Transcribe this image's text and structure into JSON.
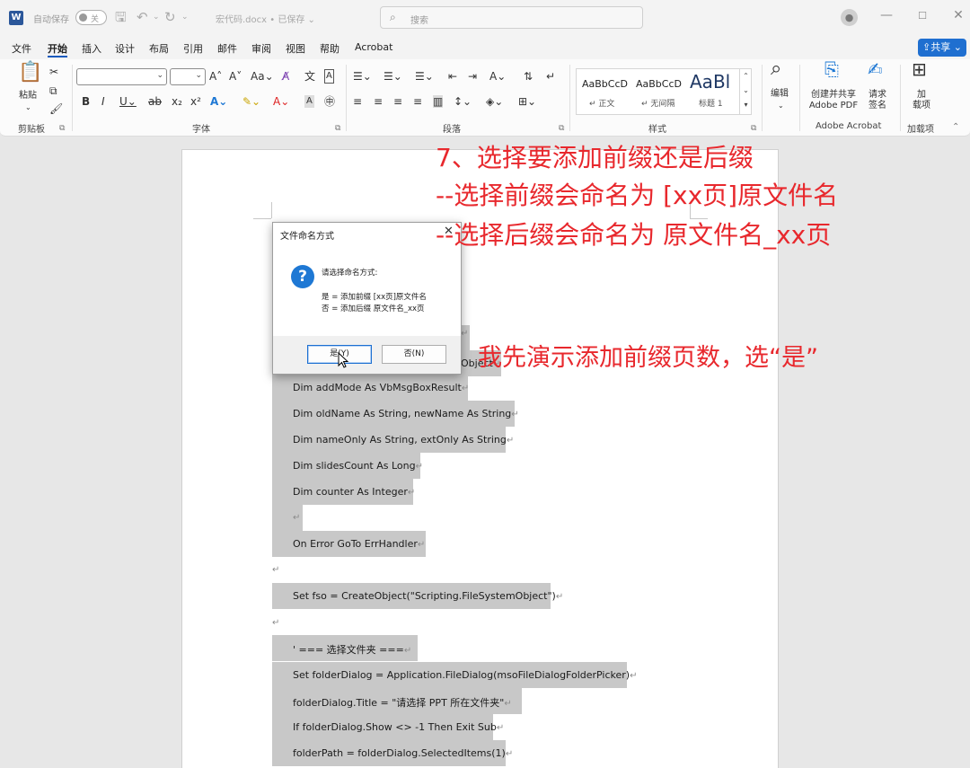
{
  "titlebar": {
    "app_icon": "W",
    "autosave": "自动保存",
    "toggle": "关",
    "doc_name": "宏代码.docx • 已保存 ⌄",
    "search_placeholder": "搜索"
  },
  "menu": {
    "items": [
      "文件",
      "开始",
      "插入",
      "设计",
      "布局",
      "引用",
      "邮件",
      "审阅",
      "视图",
      "帮助",
      "Acrobat"
    ],
    "share": "共享"
  },
  "ribbon": {
    "paste": "粘贴",
    "group_clipboard": "剪贴板",
    "group_font": "字体",
    "group_paragraph": "段落",
    "group_styles": "样式",
    "group_acrobat": "Adobe Acrobat",
    "group_addins": "加载项",
    "styles": [
      {
        "sample": "AaBbCcD",
        "name": "正文"
      },
      {
        "sample": "AaBbCcD",
        "name": "无间隔"
      },
      {
        "sample": "AaBl",
        "name": "标题 1"
      }
    ],
    "edit": "编辑",
    "create_pdf": "创建并共享",
    "create_pdf2": "Adobe PDF",
    "sign": "请求",
    "sign2": "签名",
    "addins": "加",
    "addins2": "载项"
  },
  "annotation": {
    "line1": "7、选择要添加前缀还是后缀",
    "line2": "--选择前缀会命名为  [xx页]原文件名",
    "line3": "--选择后缀会命名为  原文件名_xx页",
    "line4": "我先演示添加前缀页数，选“是”"
  },
  "dialog": {
    "title": "文件命名方式",
    "prompt": "请选择命名方式:",
    "option_yes": "是 = 添加前缀 [xx页]原文件名",
    "option_no": "否 = 添加后缀 原文件名_xx页",
    "btn_yes": "是(Y)",
    "btn_no": "否(N)"
  },
  "code": {
    "line_obj": "Object",
    "lines": [
      "Dim addMode As VbMsgBoxResult",
      "Dim oldName As String, newName As String",
      "Dim nameOnly As String, extOnly As String",
      "Dim slidesCount As Long",
      "Dim counter As Integer",
      "",
      "On Error GoTo ErrHandler",
      "Set fso = CreateObject(\"Scripting.FileSystemObject\")",
      "' ===  选择文件夹  ===",
      "Set folderDialog = Application.FileDialog(msoFileDialogFolderPicker)",
      "folderDialog.Title = \"请选择  PPT  所在文件夹\"",
      "If folderDialog.Show <> -1 Then Exit Sub",
      "folderPath = folderDialog.SelectedItems(1)"
    ]
  },
  "colors": {
    "accent": "#185abd",
    "annotation": "#e8282d",
    "highlight": "#c8c8c8"
  }
}
